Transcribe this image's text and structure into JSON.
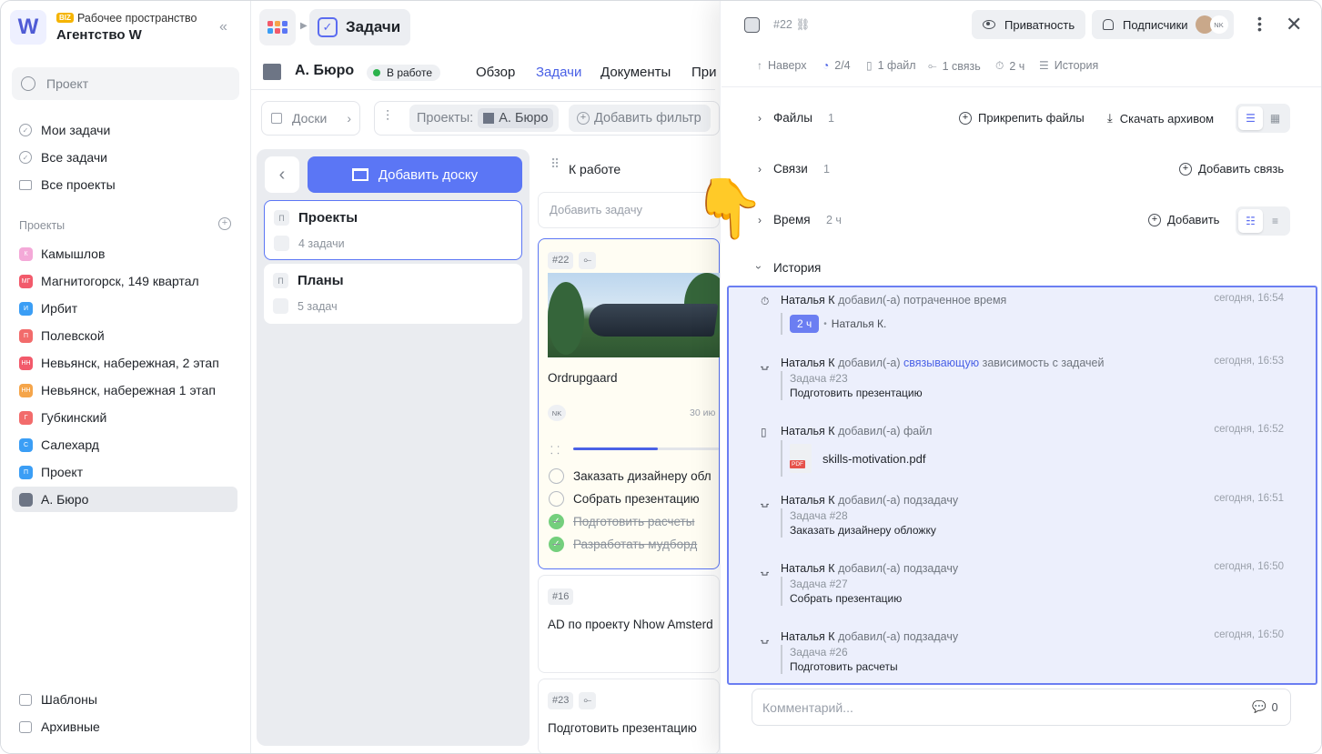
{
  "sidebar": {
    "workspace_badge": "BIZ",
    "workspace_label": "Рабочее пространство",
    "workspace_name": "Агентство W",
    "logo_letter": "W",
    "search_placeholder": "Проект",
    "nav": [
      {
        "label": "Мои задачи"
      },
      {
        "label": "Все задачи"
      },
      {
        "label": "Все проекты"
      }
    ],
    "projects_title": "Проекты",
    "projects": [
      {
        "letter": "К",
        "label": "Камышлов",
        "color": "#f4a9d8"
      },
      {
        "letter": "МГ",
        "label": "Магнитогорск, 149 квартал",
        "color": "#f25a6b"
      },
      {
        "letter": "И",
        "label": "Ирбит",
        "color": "#3b9ef5"
      },
      {
        "letter": "П",
        "label": "Полевской",
        "color": "#f26b6b"
      },
      {
        "letter": "НН",
        "label": "Невьянск, набережная, 2 этап",
        "color": "#f25a6b"
      },
      {
        "letter": "НН",
        "label": "Невьянск, набережная 1 этап",
        "color": "#f5a54a"
      },
      {
        "letter": "Г",
        "label": "Губкинский",
        "color": "#f26b6b"
      },
      {
        "letter": "С",
        "label": "Салехард",
        "color": "#3b9ef5"
      },
      {
        "letter": "П",
        "label": "Проект",
        "color": "#3b9ef5"
      },
      {
        "letter": "",
        "label": "А. Бюро",
        "color": "#6d7585"
      }
    ],
    "templates_label": "Шаблоны",
    "archive_label": "Архивные"
  },
  "header": {
    "tasks_label": "Задачи",
    "project_title": "А. Бюро",
    "status": "В работе",
    "tabs": [
      "Обзор",
      "Задачи",
      "Документы",
      "При"
    ],
    "boards_label": "Доски",
    "projects_filter_label": "Проекты:",
    "projects_filter_value": "А. Бюро",
    "add_filter_label": "Добавить фильтр"
  },
  "boards": {
    "add_board_label": "Добавить доску",
    "items": [
      {
        "letter": "П",
        "name": "Проекты",
        "count": "4 задачи"
      },
      {
        "letter": "П",
        "name": "Планы",
        "count": "5 задач"
      }
    ]
  },
  "column": {
    "title": "К работе",
    "add_task": "Добавить задачу",
    "cards": [
      {
        "id": "#22",
        "title": "Ordrupgaard",
        "assignee": "NK",
        "date": "30 ию",
        "progress": 0.58,
        "subtasks": [
          {
            "label": "Заказать дизайнеру обл",
            "done": false
          },
          {
            "label": "Собрать презентацию",
            "done": false
          },
          {
            "label": "Подготовить расчеты",
            "done": true
          },
          {
            "label": "Разработать мудборд",
            "done": true
          }
        ]
      },
      {
        "id": "#16",
        "title": "AD по проекту Nhow Amsterd"
      },
      {
        "id": "#23",
        "title": "Подготовить презентацию"
      }
    ]
  },
  "task": {
    "number": "#22",
    "privacy_label": "Приватность",
    "subscribers_label": "Подписчики",
    "subscriber_initials": "NK",
    "meta": {
      "up": "Наверх",
      "subtasks": "2/4",
      "files": "1 файл",
      "links": "1 связь",
      "time": "2 ч",
      "history": "История"
    },
    "sections": {
      "files": {
        "title": "Файлы",
        "count": "1",
        "attach": "Прикрепить файлы",
        "download": "Скачать архивом"
      },
      "links": {
        "title": "Связи",
        "count": "1",
        "add": "Добавить связь"
      },
      "time": {
        "title": "Время",
        "count": "2 ч",
        "add": "Добавить"
      },
      "history": {
        "title": "История"
      }
    },
    "history": [
      {
        "icon": "timer-icon",
        "user": "Наталья К",
        "text": "добавил(-а) потраченное время",
        "time": "сегодня, 16:54",
        "chip": "2 ч",
        "chip_user": "Наталья К."
      },
      {
        "icon": "comment-icon",
        "user": "Наталья К",
        "text_pre": "добавил(-а)",
        "link": "связывающую",
        "text_post": "зависимость с задачей",
        "time": "сегодня, 16:53",
        "ref": "Задача #23",
        "ref_title": "Подготовить презентацию"
      },
      {
        "icon": "file-icon",
        "user": "Наталья К",
        "text": "добавил(-а) файл",
        "time": "сегодня, 16:52",
        "file": "skills-motivation.pdf",
        "file_badge": "PDF"
      },
      {
        "icon": "comment-icon",
        "user": "Наталья К",
        "text": "добавил(-а) подзадачу",
        "time": "сегодня, 16:51",
        "ref": "Задача #28",
        "ref_title": "Заказать дизайнеру обложку"
      },
      {
        "icon": "comment-icon",
        "user": "Наталья К",
        "text": "добавил(-а) подзадачу",
        "time": "сегодня, 16:50",
        "ref": "Задача #27",
        "ref_title": "Собрать презентацию"
      },
      {
        "icon": "comment-icon",
        "user": "Наталья К",
        "text": "добавил(-а) подзадачу",
        "time": "сегодня, 16:50",
        "ref": "Задача #26",
        "ref_title": "Подготовить расчеты"
      }
    ],
    "comment_placeholder": "Комментарий...",
    "comment_count": "0"
  },
  "colors": {
    "accent": "#5b76f5",
    "status_green": "#2bb24c",
    "history_bg": "#eceffc"
  }
}
